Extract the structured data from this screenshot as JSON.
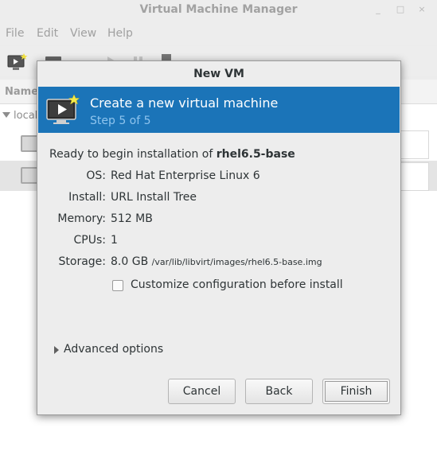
{
  "main_window": {
    "title": "Virtual Machine Manager",
    "menu": [
      "File",
      "Edit",
      "View",
      "Help"
    ],
    "list_header": "Name",
    "connection_label": "locall"
  },
  "dialog": {
    "title": "New VM",
    "banner": {
      "title": "Create a new virtual machine",
      "subtitle": "Step 5 of 5"
    },
    "summary_prefix": "Ready to begin installation of",
    "vm_name": "rhel6.5-base",
    "fields": {
      "os": {
        "label": "OS:",
        "value": "Red Hat Enterprise Linux 6"
      },
      "install": {
        "label": "Install:",
        "value": "URL Install Tree"
      },
      "memory": {
        "label": "Memory:",
        "value": "512 MB"
      },
      "cpus": {
        "label": "CPUs:",
        "value": "1"
      },
      "storage": {
        "label": "Storage:",
        "value": "8.0 GB",
        "path": "/var/lib/libvirt/images/rhel6.5-base.img"
      }
    },
    "customize_label": "Customize configuration before install",
    "customize_checked": false,
    "advanced_label": "Advanced options",
    "buttons": {
      "cancel": "Cancel",
      "back": "Back",
      "finish": "Finish"
    }
  },
  "colors": {
    "banner_bg": "#1b74b8",
    "banner_subtitle": "#8ec4ee"
  }
}
